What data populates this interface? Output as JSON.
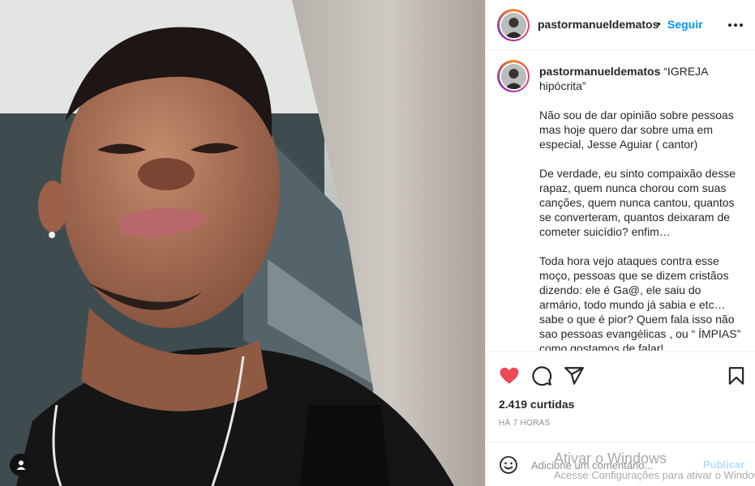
{
  "post": {
    "username": "pastormanueldematos",
    "separator": "•",
    "follow_label": "Seguir",
    "more_icon": "more-horizontal-icon",
    "caption_username": "pastormanueldematos",
    "caption_text": "“IGREJA hipócrita”\n\nNão sou de dar opinião sobre pessoas mas hoje quero dar sobre uma em especial, Jesse Aguiar ( cantor)\n\nDe verdade, eu sinto compaixão desse rapaz, quem nunca chorou com suas canções, quem nunca cantou, quantos se converteram, quantos deixaram de cometer suicídio? enfim…\n\nToda hora vejo ataques contra esse moço, pessoas que se dizem cristãos dizendo: ele é Ga@, ele saiu do armário, todo mundo já sabia e etc… sabe o que é pior? Quem fala isso não sao pessoas evangélicas , ou “ ÍMPIAS” como gostamos de falar!",
    "likes": "2.419 curtidas",
    "time": "HÁ 7 HORAS",
    "liked": true,
    "like_color": "#ed4956"
  },
  "comment": {
    "placeholder": "Adicione um comentário...",
    "publish_label": "Publicar"
  },
  "colors": {
    "accent": "#0095f6",
    "publish_disabled": "#b2dffc"
  },
  "watermark": {
    "title": "Ativar o Windows",
    "subtitle": "Acesse Configurações para ativar o Windows."
  }
}
